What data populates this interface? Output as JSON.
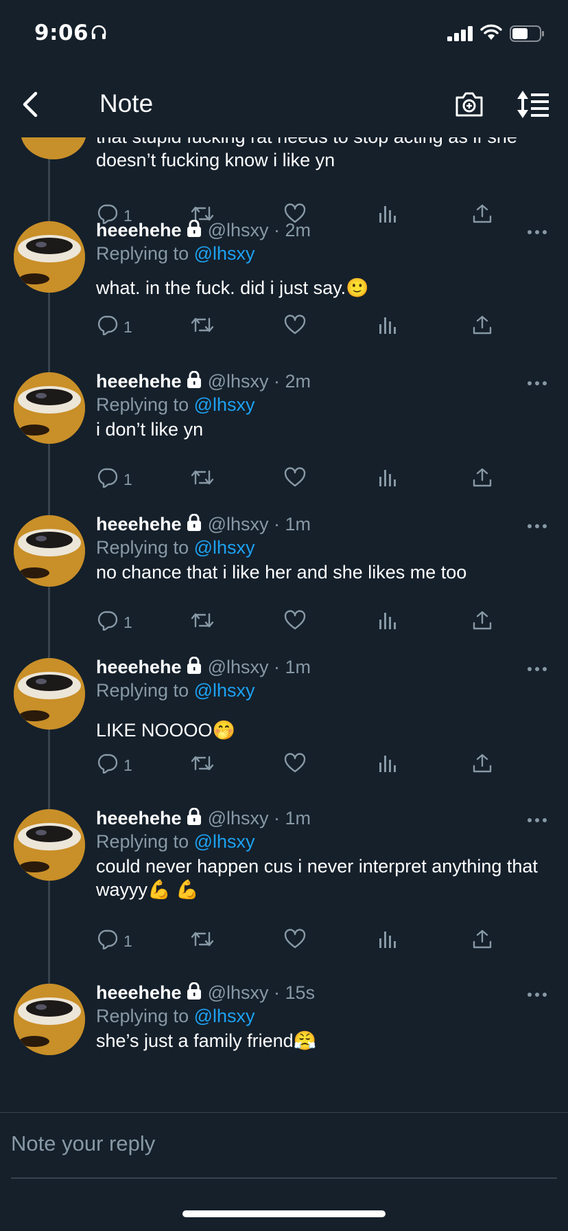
{
  "status_bar": {
    "time": "9:06",
    "icons": [
      "headphones-icon",
      "signal-icon",
      "wifi-icon",
      "battery-icon"
    ]
  },
  "nav": {
    "title": "Note",
    "back_icon": "chevron-left-icon",
    "camera_icon": "camera-plus-icon",
    "sort_icon": "sort-icon"
  },
  "colors": {
    "background": "#15202b",
    "muted": "#8899a6",
    "accent": "#1da1f2",
    "divider": "#38444d"
  },
  "top_tweet": {
    "text": "that stupid fucking rat needs to stop acting as if she doesn’t fucking know i like yn",
    "reply_count": "1"
  },
  "tweets": [
    {
      "name": "heeehehe",
      "handle_time": "@lhsxy · 2m",
      "replying_label": "Replying to",
      "mention": "@lhsxy",
      "text": "what. in the fuck. did i just say.🙂",
      "reply_count": "1"
    },
    {
      "name": "heeehehe",
      "handle_time": "@lhsxy · 2m",
      "replying_label": "Replying to",
      "mention": "@lhsxy",
      "text": "i don’t like yn",
      "reply_count": "1"
    },
    {
      "name": "heeehehe",
      "handle_time": "@lhsxy · 1m",
      "replying_label": "Replying to",
      "mention": "@lhsxy",
      "text": "no chance that i like her and she likes me too",
      "reply_count": "1"
    },
    {
      "name": "heeehehe",
      "handle_time": "@lhsxy · 1m",
      "replying_label": "Replying to",
      "mention": "@lhsxy",
      "text": "LIKE NOOOO🤭",
      "reply_count": "1"
    },
    {
      "name": "heeehehe",
      "handle_time": "@lhsxy · 1m",
      "replying_label": "Replying to",
      "mention": "@lhsxy",
      "text": "could never happen cus i never interpret anything that wayyy💪 💪",
      "reply_count": "1"
    },
    {
      "name": "heeehehe",
      "handle_time": "@lhsxy · 15s",
      "replying_label": "Replying to",
      "mention": "@lhsxy",
      "text": "she’s just a family friend😤",
      "reply_count": ""
    }
  ],
  "reply_box": {
    "placeholder": "Note your reply"
  }
}
